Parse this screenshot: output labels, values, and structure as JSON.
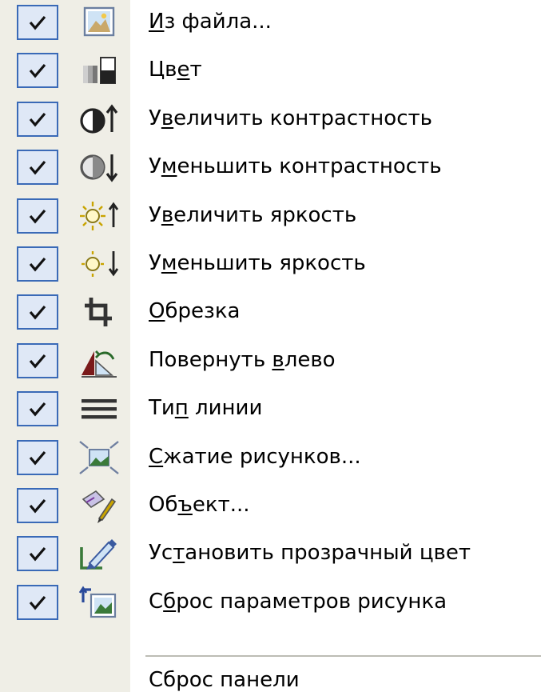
{
  "menu": {
    "items": [
      {
        "text": "Из файла...",
        "underline": 0,
        "icon": "picture-from-file-icon",
        "checked": true
      },
      {
        "text": "Цвет",
        "underline": 2,
        "icon": "color-icon",
        "checked": true
      },
      {
        "text": "Увеличить контрастность",
        "underline": 1,
        "icon": "more-contrast-icon",
        "checked": true
      },
      {
        "text": "Уменьшить контрастность",
        "underline": 1,
        "icon": "less-contrast-icon",
        "checked": true
      },
      {
        "text": "Увеличить яркость",
        "underline": 1,
        "icon": "more-brightness-icon",
        "checked": true
      },
      {
        "text": "Уменьшить яркость",
        "underline": 1,
        "icon": "less-brightness-icon",
        "checked": true
      },
      {
        "text": "Обрезка",
        "underline": 0,
        "icon": "crop-icon",
        "checked": true
      },
      {
        "text": "Повернуть влево",
        "underline": 10,
        "icon": "rotate-left-icon",
        "checked": true
      },
      {
        "text": "Тип линии",
        "underline": 2,
        "icon": "line-style-icon",
        "checked": true
      },
      {
        "text": "Сжатие рисунков...",
        "underline": 0,
        "icon": "compress-pictures-icon",
        "checked": true
      },
      {
        "text": "Объект...",
        "underline": 2,
        "icon": "format-object-icon",
        "checked": true
      },
      {
        "text": "Установить прозрачный цвет",
        "underline": 2,
        "icon": "set-transparent-color-icon",
        "checked": true
      },
      {
        "text": "Сброс параметров рисунка",
        "underline": 1,
        "icon": "reset-picture-icon",
        "checked": true
      }
    ],
    "reset_label": "Сброс панели"
  },
  "colors": {
    "strip": "#efeee6",
    "check_border": "#3a6ab7",
    "check_fill": "#dfe8f6"
  }
}
